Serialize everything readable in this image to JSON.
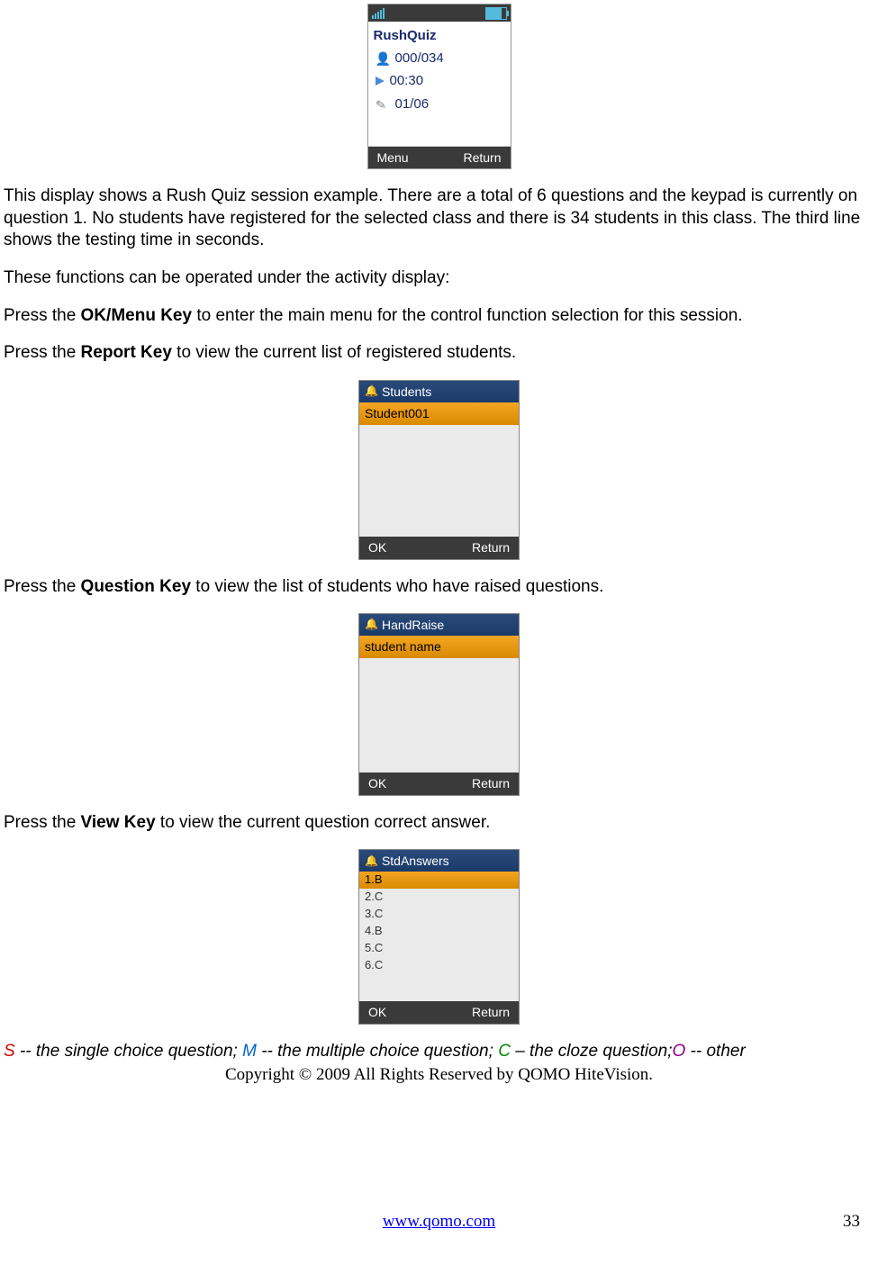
{
  "phone1": {
    "title": "RushQuiz",
    "students": "000/034",
    "time": "00:30",
    "question": "01/06",
    "menu": "Menu",
    "return": "Return"
  },
  "para1": "This display shows a Rush Quiz session example. There are a total of 6 questions and the keypad is currently on question 1. No students have registered for the selected class and there is  34 students in this class. The third line shows the testing time in seconds.",
  "para2": "These functions can be operated under the activity display:",
  "para3_pre": "Press the ",
  "para3_bold": "OK/Menu Key",
  "para3_post": " to enter the main menu for the control function selection for this session.",
  "para4_pre": "Press the ",
  "para4_bold": "Report Key",
  "para4_post": " to view the current list of registered students.",
  "mini1": {
    "header": "Students",
    "row": "Student001",
    "ok": "OK",
    "return": "Return"
  },
  "para5_pre": "Press the ",
  "para5_bold": "Question Key",
  "para5_post": " to view the list of students who have raised questions.",
  "mini2": {
    "header": "HandRaise",
    "row": "student name",
    "ok": "OK",
    "return": "Return"
  },
  "para6_pre": "Press the ",
  "para6_bold": "View Key",
  "para6_post": " to view the current question correct answer.",
  "mini3": {
    "header": "StdAnswers",
    "a1": "1.B",
    "a2": "2.C",
    "a3": "3.C",
    "a4": "4.B",
    "a5": "5.C",
    "a6": "6.C",
    "ok": "OK",
    "return": "Return"
  },
  "legend": {
    "s": "S",
    "s_text": " -- the single choice question; ",
    "m": "M",
    "m_text": " -- the multiple choice question; ",
    "c": "C",
    "c_text": " – the cloze question",
    "semi": ";",
    "o": "O",
    "o_text": " -- other"
  },
  "copyright": "Copyright © 2009 All Rights Reserved by QOMO HiteVision.",
  "url": "www.qomo.com",
  "page": "33"
}
